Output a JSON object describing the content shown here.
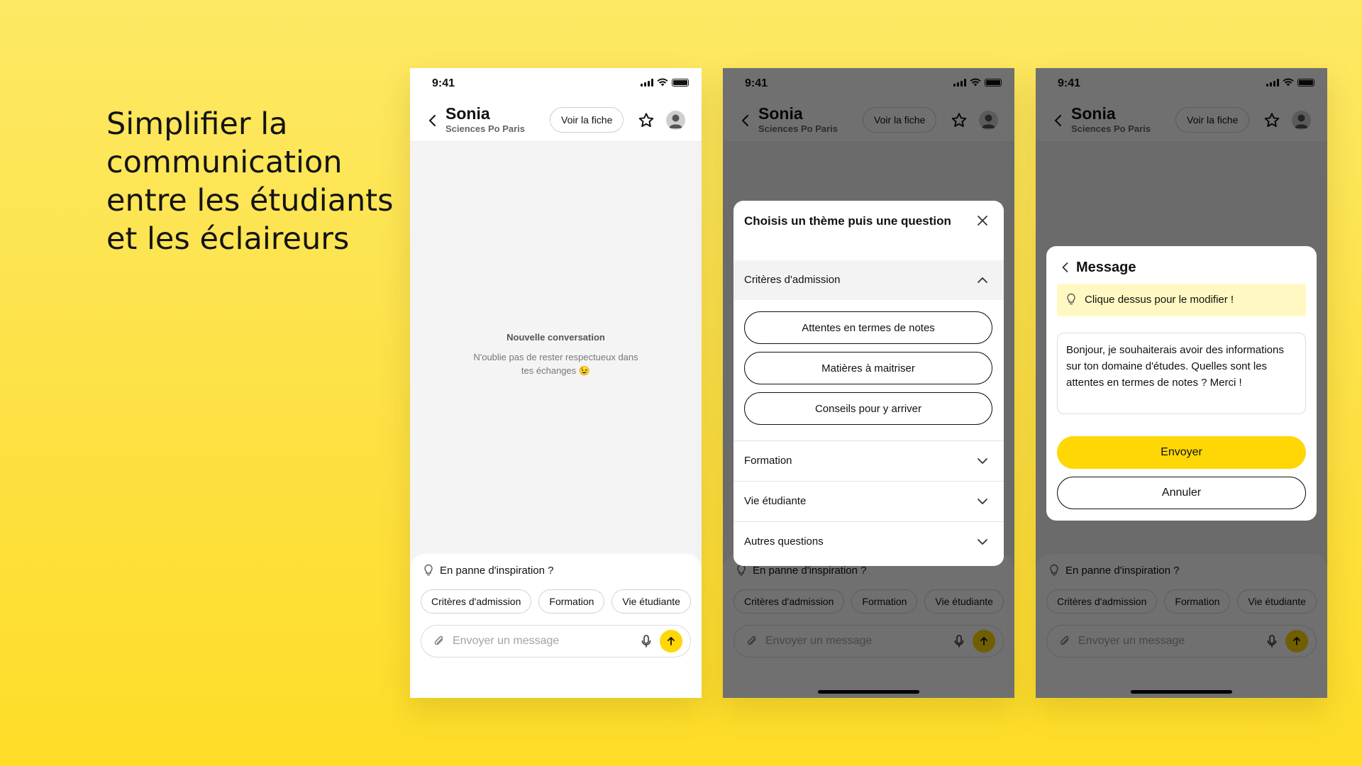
{
  "headline": "Simplifier la communication entre les étudiants et les éclaireurs",
  "status": {
    "time": "9:41"
  },
  "header": {
    "name": "Sonia",
    "school": "Sciences Po Paris",
    "voir_label": "Voir la fiche"
  },
  "empty": {
    "title": "Nouvelle conversation",
    "subtitle": "N'oublie pas de rester respectueux dans tes échanges 😉"
  },
  "composer": {
    "inspiration": "En panne d'inspiration ?",
    "chips": [
      "Critères d'admission",
      "Formation",
      "Vie étudiante"
    ],
    "placeholder": "Envoyer un message"
  },
  "sheet": {
    "title": "Choisis un thème puis une question",
    "open_section": "Critères d'admission",
    "questions": [
      "Attentes en termes de notes",
      "Matières à maitriser",
      "Conseils pour y arriver"
    ],
    "sections": [
      "Formation",
      "Vie étudiante",
      "Autres questions"
    ]
  },
  "dialog": {
    "title": "Message",
    "hint": "Clique dessus pour le modifier !",
    "message": "Bonjour, je souhaiterais avoir des informations sur ton domaine d'études. Quelles sont les attentes en termes de notes ? Merci !",
    "send_label": "Envoyer",
    "cancel_label": "Annuler"
  },
  "colors": {
    "accent": "#fed705",
    "background": "#fde24a",
    "overlay": "#000000"
  },
  "icons": [
    "chevron-left-icon",
    "star-icon",
    "avatar-icon",
    "lightbulb-icon",
    "paperclip-icon",
    "mic-icon",
    "arrow-up-icon",
    "close-icon",
    "chevron-up-icon",
    "chevron-down-icon"
  ]
}
